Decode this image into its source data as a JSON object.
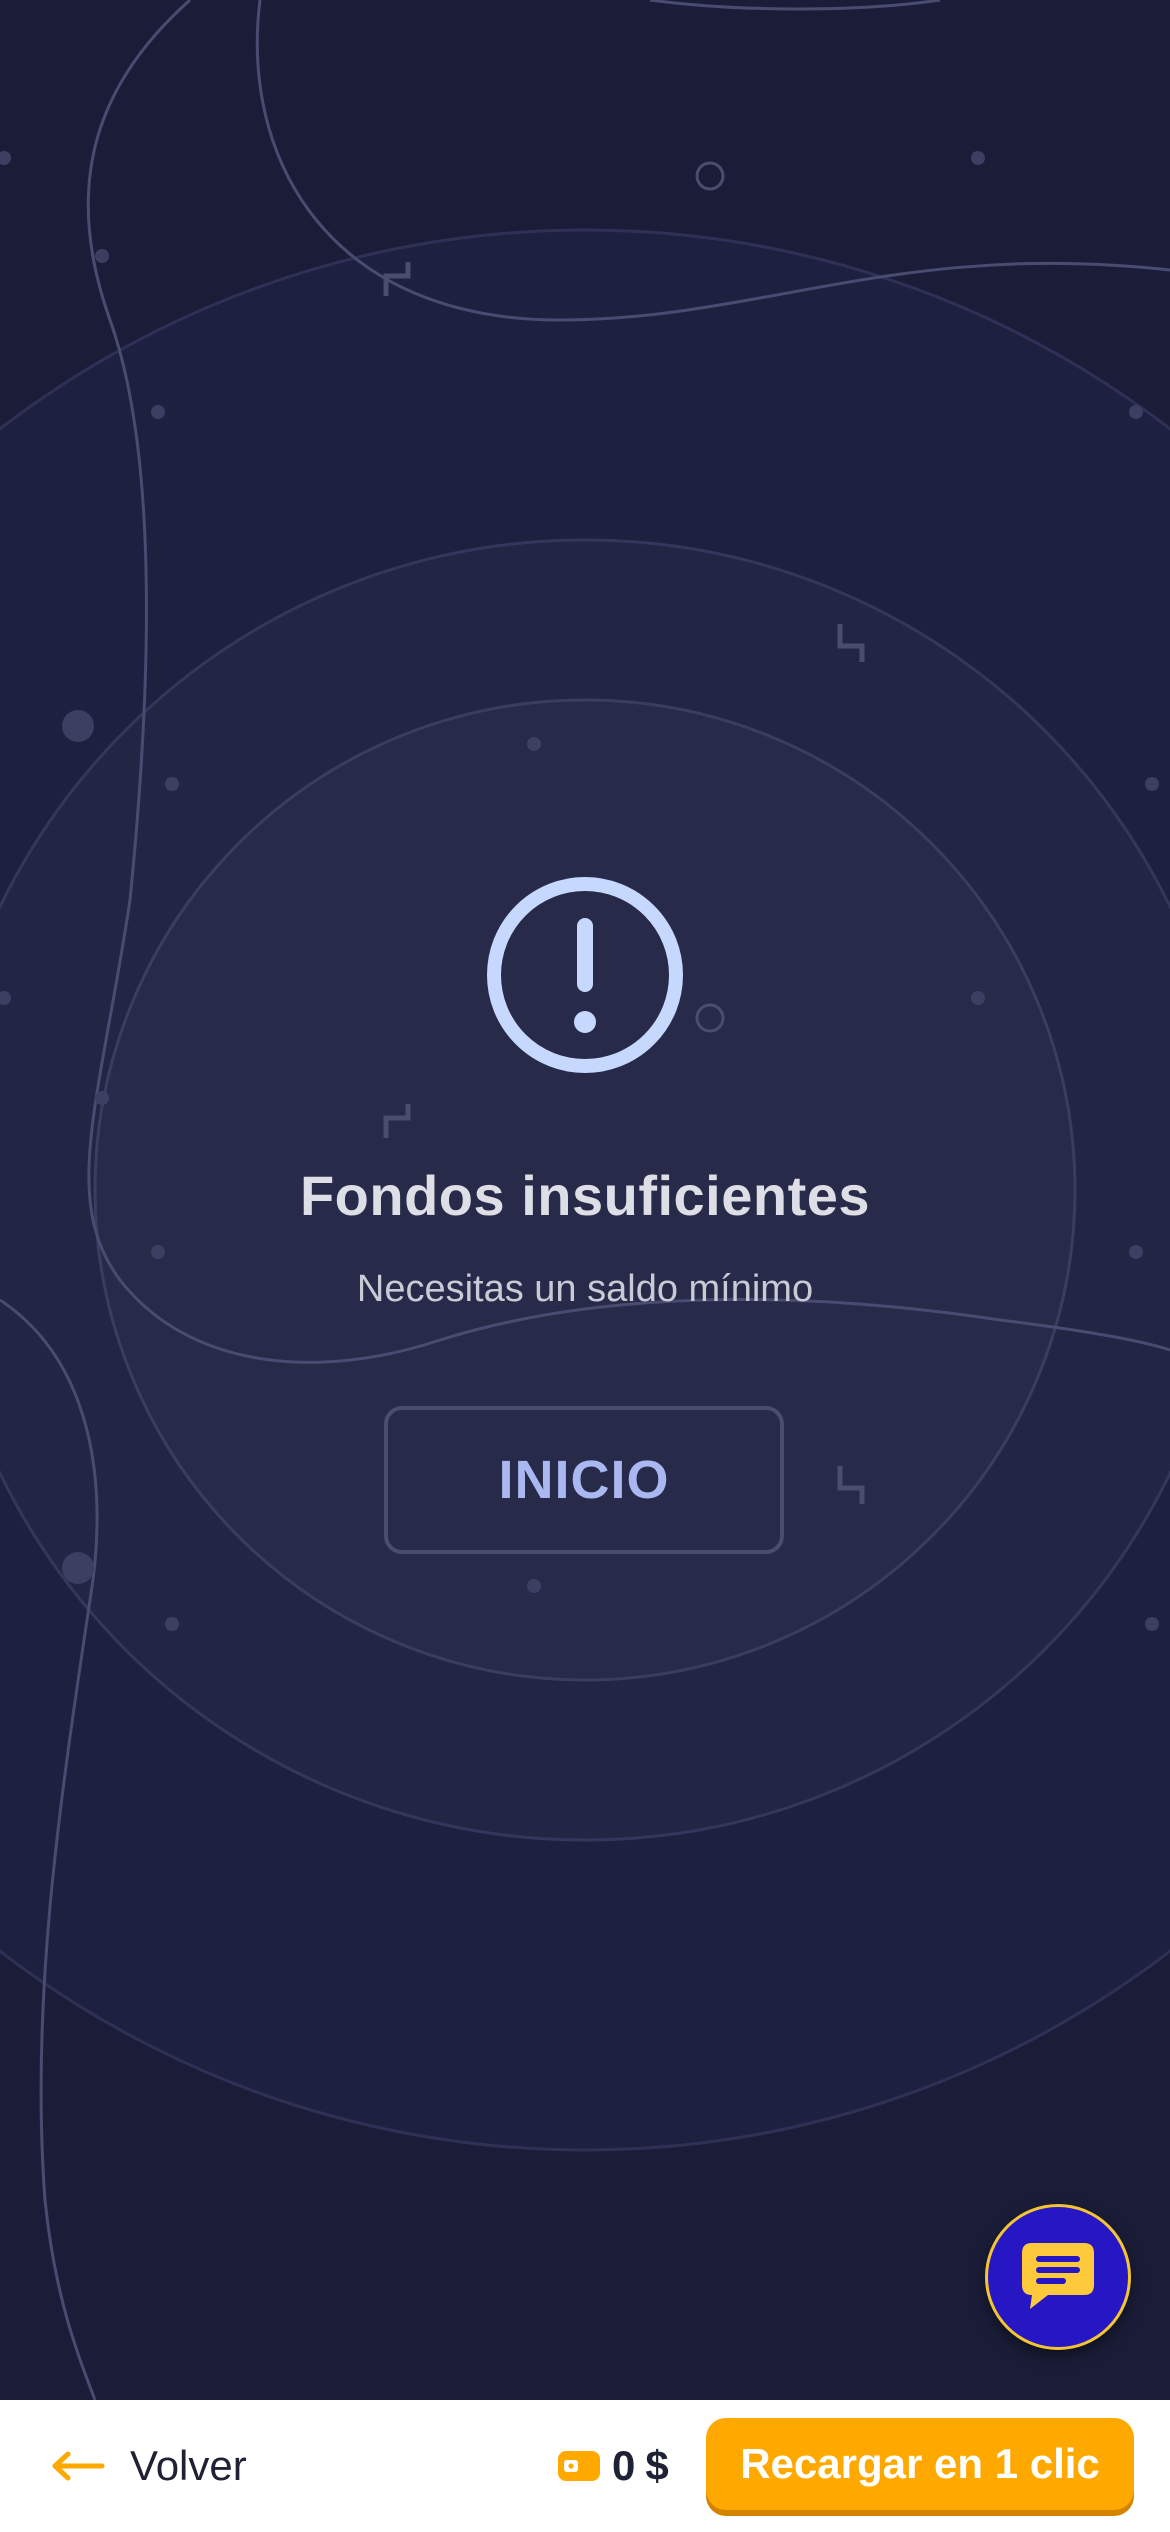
{
  "dialog": {
    "title": "Fondos insuficientes",
    "message": "Necesitas un saldo mínimo",
    "home_button_label": "INICIO"
  },
  "icons": {
    "alert": "exclamation-circle-icon",
    "chat": "chat-bubble-icon",
    "back": "arrow-left-icon",
    "wallet": "wallet-icon"
  },
  "bottom_bar": {
    "back_label": "Volver",
    "balance_amount": "0",
    "balance_currency": "$",
    "recharge_label": "Recargar en 1 clic"
  },
  "colors": {
    "background": "#1b1d38",
    "accent_orange": "#ffa800",
    "chat_button": "#2616c4",
    "chat_border": "#f4c532",
    "icon_light_blue": "#c7d8ff"
  }
}
